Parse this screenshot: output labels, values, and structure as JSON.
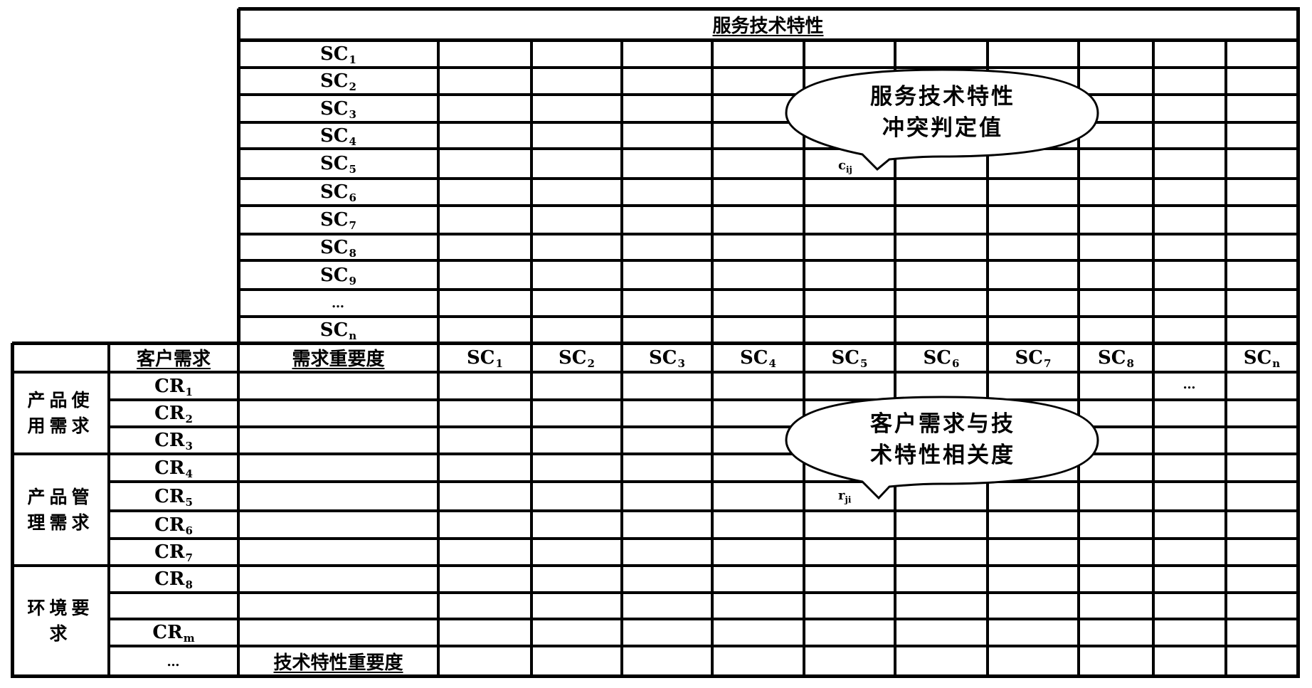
{
  "title": "服务技术特性",
  "top_block": {
    "rows": [
      {
        "base": "SC",
        "sub": "1"
      },
      {
        "base": "SC",
        "sub": "2"
      },
      {
        "base": "SC",
        "sub": "3"
      },
      {
        "base": "SC",
        "sub": "4"
      },
      {
        "base": "SC",
        "sub": "5"
      },
      {
        "base": "SC",
        "sub": "6"
      },
      {
        "base": "SC",
        "sub": "7"
      },
      {
        "base": "SC",
        "sub": "8"
      },
      {
        "base": "SC",
        "sub": "9"
      },
      {
        "base": "…",
        "sub": ""
      },
      {
        "base": "SC",
        "sub": "n"
      }
    ]
  },
  "header": {
    "corner": "",
    "customer_needs": "客户需求",
    "need_importance": "需求重要度",
    "columns": [
      {
        "base": "SC",
        "sub": "1"
      },
      {
        "base": "SC",
        "sub": "2"
      },
      {
        "base": "SC",
        "sub": "3"
      },
      {
        "base": "SC",
        "sub": "4"
      },
      {
        "base": "SC",
        "sub": "5"
      },
      {
        "base": "SC",
        "sub": "6"
      },
      {
        "base": "SC",
        "sub": "7"
      },
      {
        "base": "SC",
        "sub": "8"
      },
      {
        "base": "…",
        "sub": ""
      },
      {
        "base": "SC",
        "sub": "n"
      }
    ]
  },
  "groups": [
    {
      "label": "产品使用需求",
      "rows": [
        {
          "base": "CR",
          "sub": "1"
        },
        {
          "base": "CR",
          "sub": "2"
        },
        {
          "base": "CR",
          "sub": "3"
        }
      ]
    },
    {
      "label": "产品管理需求",
      "rows": [
        {
          "base": "CR",
          "sub": "4"
        },
        {
          "base": "CR",
          "sub": "5"
        },
        {
          "base": "CR",
          "sub": "6"
        },
        {
          "base": "CR",
          "sub": "7"
        }
      ]
    },
    {
      "label": "环境要求",
      "rows": [
        {
          "base": "CR",
          "sub": "8"
        },
        {
          "base": "…",
          "sub": ""
        },
        {
          "base": "CR",
          "sub": "m"
        }
      ]
    }
  ],
  "footer": {
    "label": "技术特性重要度"
  },
  "callouts": [
    {
      "text_line1": "服务技术特性",
      "text_line2": "冲突判定值",
      "var_base": "c",
      "var_sub": "ij"
    },
    {
      "text_line1": "客户需求与技",
      "text_line2": "术特性相关度",
      "var_base": "r",
      "var_sub": "ji"
    }
  ]
}
